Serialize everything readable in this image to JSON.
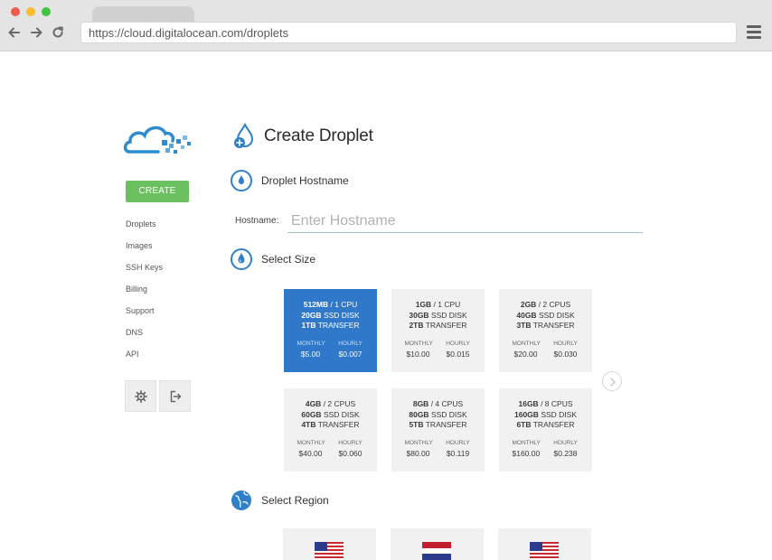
{
  "browser": {
    "url": "https://cloud.digitalocean.com/droplets"
  },
  "sidebar": {
    "create_label": "CREATE",
    "items": [
      {
        "label": "Droplets"
      },
      {
        "label": "Images"
      },
      {
        "label": "SSH Keys"
      },
      {
        "label": "Billing"
      },
      {
        "label": "Support"
      },
      {
        "label": "DNS"
      },
      {
        "label": "API"
      }
    ]
  },
  "main": {
    "title": "Create Droplet",
    "sections": {
      "hostname": "Droplet Hostname",
      "size": "Select Size",
      "region": "Select Region"
    },
    "hostname_label": "Hostname:",
    "hostname_placeholder": "Enter Hostname",
    "hostname_value": "",
    "price_headers": {
      "monthly": "MONTHLY",
      "hourly": "HOURLY"
    },
    "sizes": [
      {
        "memory": "512MB",
        "cpu": "1 CPU",
        "disk": "20GB",
        "disk_label": "SSD DISK",
        "transfer": "1TB",
        "transfer_label": "TRANSFER",
        "monthly": "$5.00",
        "hourly": "$0.007",
        "selected": true
      },
      {
        "memory": "1GB",
        "cpu": "1 CPU",
        "disk": "30GB",
        "disk_label": "SSD DISK",
        "transfer": "2TB",
        "transfer_label": "TRANSFER",
        "monthly": "$10.00",
        "hourly": "$0.015",
        "selected": false
      },
      {
        "memory": "2GB",
        "cpu": "2 CPUS",
        "disk": "40GB",
        "disk_label": "SSD DISK",
        "transfer": "3TB",
        "transfer_label": "TRANSFER",
        "monthly": "$20.00",
        "hourly": "$0.030",
        "selected": false
      },
      {
        "memory": "4GB",
        "cpu": "2 CPUS",
        "disk": "60GB",
        "disk_label": "SSD DISK",
        "transfer": "4TB",
        "transfer_label": "TRANSFER",
        "monthly": "$40.00",
        "hourly": "$0.060",
        "selected": false
      },
      {
        "memory": "8GB",
        "cpu": "4 CPUS",
        "disk": "80GB",
        "disk_label": "SSD DISK",
        "transfer": "5TB",
        "transfer_label": "TRANSFER",
        "monthly": "$80.00",
        "hourly": "$0.119",
        "selected": false
      },
      {
        "memory": "16GB",
        "cpu": "8 CPUS",
        "disk": "160GB",
        "disk_label": "SSD DISK",
        "transfer": "6TB",
        "transfer_label": "TRANSFER",
        "monthly": "$160.00",
        "hourly": "$0.238",
        "selected": false
      }
    ],
    "regions": [
      {
        "flag": "us-flag-icon"
      },
      {
        "flag": "netherlands-flag-icon"
      },
      {
        "flag": "us-flag-icon"
      }
    ]
  },
  "colors": {
    "accent": "#3078c9",
    "create_green": "#6bc15f",
    "card_bg": "#f1f1f1"
  }
}
